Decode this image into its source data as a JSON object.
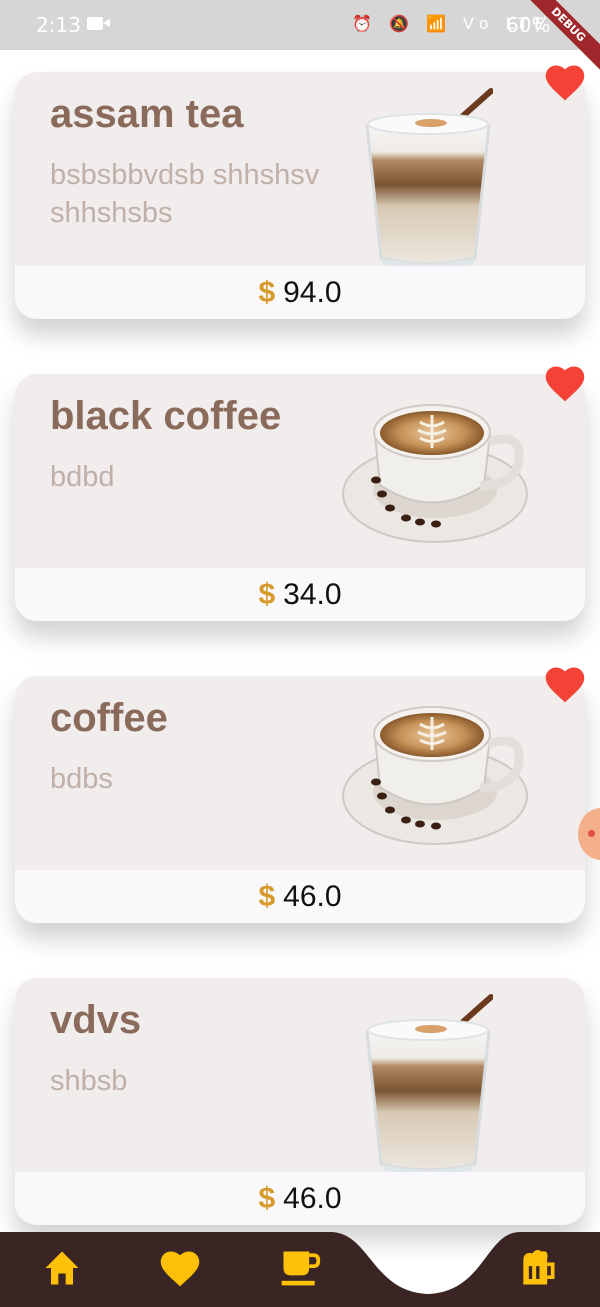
{
  "status_bar": {
    "time": "2:13",
    "icons": "⏰ 🔕 📶 Vo LTE",
    "battery": "60%"
  },
  "debug_label": "DEBUG",
  "colors": {
    "accent": "#ffc107",
    "nav_bg": "#3b2524",
    "heart": "#f44336",
    "title": "#8a6a5a",
    "desc": "#c0b1a8",
    "dollar": "#d79a2c"
  },
  "products": [
    {
      "name": "assam tea",
      "description": "bsbsbbvdsb shhshsv shhshsbs",
      "currency": "$",
      "price": "94.0",
      "image": "iced-latte-glass",
      "favorite": true
    },
    {
      "name": "black coffee",
      "description": "bdbd",
      "currency": "$",
      "price": "34.0",
      "image": "latte-art-cup",
      "favorite": true
    },
    {
      "name": "coffee",
      "description": "bdbs",
      "currency": "$",
      "price": "46.0",
      "image": "latte-art-cup",
      "favorite": true
    },
    {
      "name": "vdvs",
      "description": "shbsb",
      "currency": "$",
      "price": "46.0",
      "image": "iced-latte-glass",
      "favorite": false
    }
  ],
  "bottom_nav": {
    "items": [
      {
        "icon": "home-icon"
      },
      {
        "icon": "heart-icon"
      },
      {
        "icon": "coffee-cup-icon"
      },
      {
        "icon": "beer-mug-icon",
        "selected": true
      }
    ]
  }
}
